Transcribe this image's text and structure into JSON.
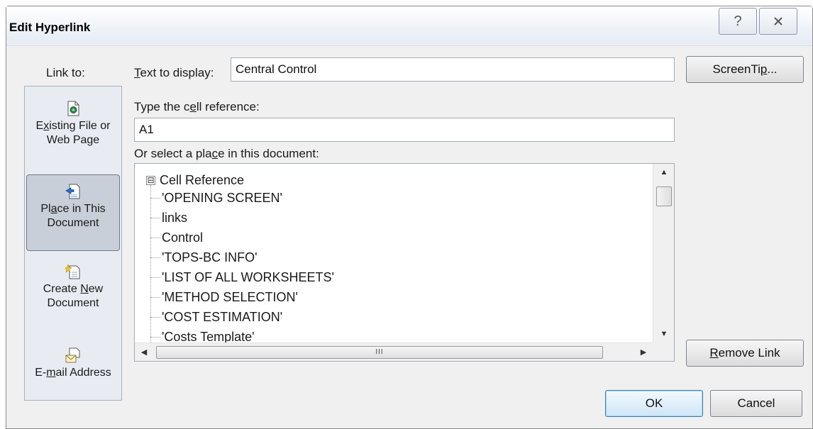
{
  "window": {
    "title": "Edit Hyperlink",
    "help_symbol": "?"
  },
  "link_to": {
    "label": "Link to:",
    "items": [
      {
        "pre": "E",
        "u": "x",
        "post": "isting File or",
        "line2": "Web Page",
        "icon": "existing-file-icon"
      },
      {
        "pre": "Pl",
        "u": "a",
        "post": "ce in This",
        "line2": "Document",
        "icon": "document-place-icon",
        "selected": true
      },
      {
        "pre": "Create ",
        "u": "N",
        "post": "ew",
        "line2": "Document",
        "icon": "new-document-icon"
      },
      {
        "pre": "E-",
        "u": "m",
        "post": "ail Address",
        "line2": "",
        "icon": "email-icon"
      }
    ]
  },
  "text_to_display": {
    "label_pre": "",
    "label_u": "T",
    "label_post": "ext to display:",
    "value": "Central Control"
  },
  "screentip_button": {
    "pre": "ScreenTi",
    "u": "p",
    "post": "..."
  },
  "cell_reference": {
    "label_pre": "Type the c",
    "label_u": "e",
    "label_post": "ll reference:",
    "value": "A1"
  },
  "place_select": {
    "label_pre": "Or select a pla",
    "label_u": "c",
    "label_post": "e in this document:",
    "root": "Cell Reference",
    "expander": "⊟",
    "items": [
      "'OPENING SCREEN'",
      "links",
      "Control",
      "'TOPS-BC INFO'",
      "'LIST OF ALL WORKSHEETS'",
      "'METHOD SELECTION'",
      "'COST ESTIMATION'",
      "'Costs Template'"
    ],
    "hscroll_grip": "III"
  },
  "remove_link_button": {
    "pre": "",
    "u": "R",
    "post": "emove Link"
  },
  "ok_button": "OK",
  "cancel_button": "Cancel",
  "colors": {
    "dialog_bg": "#f0f0f0",
    "selected_item_bg": "#c9cfd8",
    "default_button_border": "#3c7fb1"
  }
}
